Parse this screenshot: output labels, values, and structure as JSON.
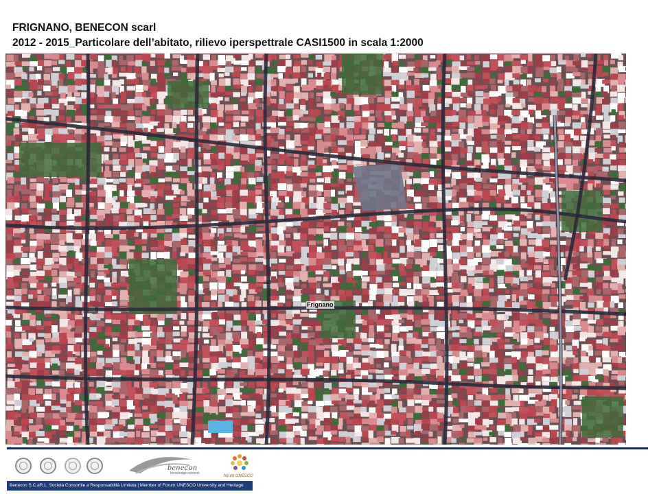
{
  "header": {
    "title": "FRIGNANO, BENECON scarl",
    "subtitle": "2012 - 2015_Particolare dell’abitato, rilievo iperspettrale CASI1500  in scala 1:2000"
  },
  "map": {
    "place_label": "Frignano",
    "colors": {
      "roof_red": "#c0505a",
      "roof_pink": "#d98a8e",
      "street": "#2a2a3a",
      "vegetation": "#3f6b3a",
      "plaza": "#6f7488"
    }
  },
  "footer": {
    "logos": [
      "seal-icon",
      "seal-icon",
      "seal-icon",
      "seal-icon",
      "benecon-logo",
      "forum-unesco-logo"
    ],
    "benecon_name": "benecon",
    "benecon_sub": "knowledge network",
    "forum_text": "forum UNESCO",
    "bar_text": "Benecon S.C.aR.L. Società Consortile a Responsabilità Limitata | Member of Forum UNESCO University and Heritage"
  }
}
